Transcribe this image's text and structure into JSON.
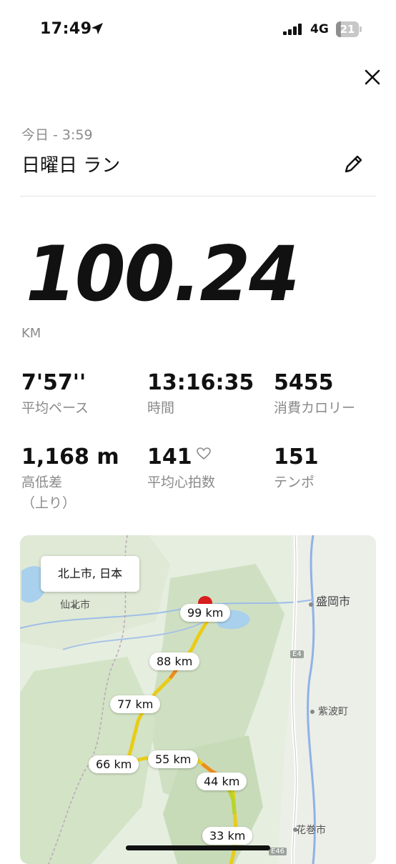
{
  "status_bar": {
    "time": "17:49",
    "network": "4G",
    "battery": "21",
    "battery_level": 0.21
  },
  "header": {
    "date": "今日 - 3:59",
    "title": "日曜日 ラン"
  },
  "summary": {
    "distance": "100.24",
    "unit": "KM"
  },
  "stats": [
    {
      "value": "7'57''",
      "label": "平均ペース"
    },
    {
      "value": "13:16:35",
      "label": "時間"
    },
    {
      "value": "5455",
      "label": "消費カロリー"
    },
    {
      "value": "1,168 m",
      "label": "高低差",
      "label2": "（上り）"
    },
    {
      "value": "141",
      "label": "平均心拍数"
    },
    {
      "value": "151",
      "label": "テンポ"
    }
  ],
  "map": {
    "location_callout": "北上市, 日本",
    "place_labels": [
      "仙北市",
      "盛岡市",
      "紫波町",
      "花巻市"
    ],
    "road_labels": [
      "E4",
      "E46"
    ],
    "km_markers": [
      "99 km",
      "88 km",
      "77 km",
      "66 km",
      "55 km",
      "44 km",
      "33 km"
    ]
  },
  "icons": {
    "close": "close-icon",
    "edit": "pencil-icon",
    "location": "location-arrow-icon",
    "heart": "heart-icon"
  },
  "colors": {
    "route_yellow": "#e8cc1a",
    "route_orange": "#f08c1c",
    "route_green": "#b7d42a",
    "pin_red": "#d81e1e"
  }
}
